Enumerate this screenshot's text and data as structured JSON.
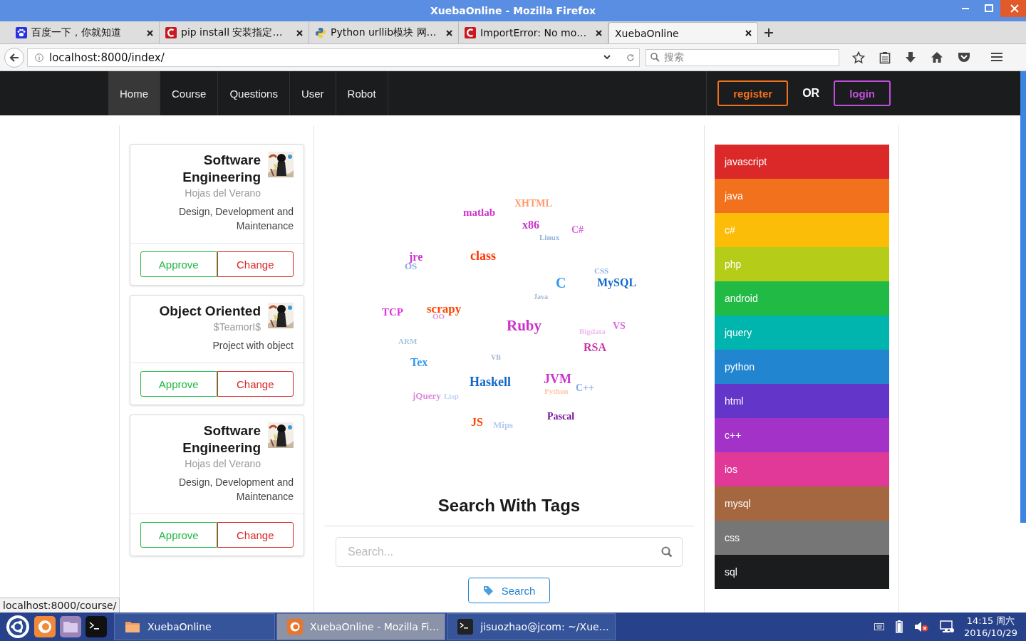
{
  "window": {
    "title": "XuebaOnline - Mozilla Firefox"
  },
  "browser_tabs": [
    {
      "label": "百度一下，你就知道",
      "kind": "paw",
      "selected": false
    },
    {
      "label": "pip install 安装指定…",
      "kind": "red-c",
      "selected": false
    },
    {
      "label": "Python urllib模块 网…",
      "kind": "python",
      "selected": false
    },
    {
      "label": "ImportError: No mo…",
      "kind": "red-c",
      "selected": false
    },
    {
      "label": "XuebaOnline",
      "kind": "none",
      "selected": true
    }
  ],
  "address_bar": {
    "url": "localhost:8000/index/"
  },
  "search_bar": {
    "placeholder": "搜索"
  },
  "navbar": {
    "items": [
      {
        "label": "Home",
        "selected": true
      },
      {
        "label": "Course",
        "selected": false
      },
      {
        "label": "Questions",
        "selected": false
      },
      {
        "label": "User",
        "selected": false
      },
      {
        "label": "Robot",
        "selected": false
      }
    ],
    "register": "register",
    "or": "OR",
    "login": "login"
  },
  "courses": [
    {
      "title": "Software Engineering",
      "teacher": "Hojas del Verano",
      "description": "Design, Development and Maintenance",
      "approve": "Approve",
      "change": "Change"
    },
    {
      "title": "Object Oriented",
      "teacher": "$TeamorI$",
      "description": "Project with object",
      "approve": "Approve",
      "change": "Change"
    },
    {
      "title": "Software Engineering",
      "teacher": "Hojas del Verano",
      "description": "Design, Development and Maintenance",
      "approve": "Approve",
      "change": "Change"
    }
  ],
  "tag_cloud": [
    {
      "text": "XHTML",
      "color": "#ff9966"
    },
    {
      "text": "matlab",
      "color": "#cc33cc"
    },
    {
      "text": "x86",
      "color": "#cc33cc"
    },
    {
      "text": "C#",
      "color": "#dd66dd"
    },
    {
      "text": "Linux",
      "color": "#93b2dc"
    },
    {
      "text": "jre",
      "color": "#cc33cc"
    },
    {
      "text": "class",
      "color": "#ff3300"
    },
    {
      "text": "OS",
      "color": "#88aadd"
    },
    {
      "text": "CSS",
      "color": "#8fb4e6"
    },
    {
      "text": "C",
      "color": "#3399ee"
    },
    {
      "text": "MySQL",
      "color": "#1166cc"
    },
    {
      "text": "Java",
      "color": "#a2b6d2"
    },
    {
      "text": "TCP",
      "color": "#dd33dd"
    },
    {
      "text": "scrapy",
      "color": "#ff4400"
    },
    {
      "text": "OO",
      "color": "#e090d4"
    },
    {
      "text": "Ruby",
      "color": "#cc33cc"
    },
    {
      "text": "Bigdata",
      "color": "#eebbee"
    },
    {
      "text": "VS",
      "color": "#dd66dd"
    },
    {
      "text": "ARM",
      "color": "#aac4e4"
    },
    {
      "text": "RSA",
      "color": "#cc33aa"
    },
    {
      "text": "VB",
      "color": "#a0b6d4"
    },
    {
      "text": "Tex",
      "color": "#3399ee"
    },
    {
      "text": "Haskell",
      "color": "#1166cc"
    },
    {
      "text": "JVM",
      "color": "#cc33cc"
    },
    {
      "text": "Python",
      "color": "#ffc8aa"
    },
    {
      "text": "C++",
      "color": "#88aaee"
    },
    {
      "text": "jQuery",
      "color": "#dd88dd"
    },
    {
      "text": "Lisp",
      "color": "#c0d4f0"
    },
    {
      "text": "JS",
      "color": "#ff4400"
    },
    {
      "text": "Mips",
      "color": "#b4ccf0"
    },
    {
      "text": "Pascal",
      "color": "#771199"
    }
  ],
  "search_section": {
    "heading": "Search With Tags",
    "placeholder": "Search...",
    "button": "Search"
  },
  "tags": [
    {
      "label": "javascript",
      "color": "#db2828"
    },
    {
      "label": "java",
      "color": "#f2711c"
    },
    {
      "label": "c#",
      "color": "#fbbd08"
    },
    {
      "label": "php",
      "color": "#b5cc18"
    },
    {
      "label": "android",
      "color": "#21ba45"
    },
    {
      "label": "jquery",
      "color": "#00b5ad"
    },
    {
      "label": "python",
      "color": "#2185d0"
    },
    {
      "label": "html",
      "color": "#6435c9"
    },
    {
      "label": "c++",
      "color": "#a333c8"
    },
    {
      "label": "ios",
      "color": "#e03997"
    },
    {
      "label": "mysql",
      "color": "#a5673f"
    },
    {
      "label": "css",
      "color": "#767676"
    },
    {
      "label": "sql",
      "color": "#1b1c1d"
    }
  ],
  "status_text": "localhost:8000/course/",
  "taskbar": {
    "windows": [
      {
        "label": "XuebaOnline",
        "kind": "folder",
        "selected": false
      },
      {
        "label": "XuebaOnline - Mozilla Fi…",
        "kind": "firefox",
        "selected": true
      },
      {
        "label": "jisuozhao@jcom: ~/Xue…",
        "kind": "terminal",
        "selected": false
      }
    ],
    "time": "14:15 周六",
    "date": "2016/10/29"
  }
}
